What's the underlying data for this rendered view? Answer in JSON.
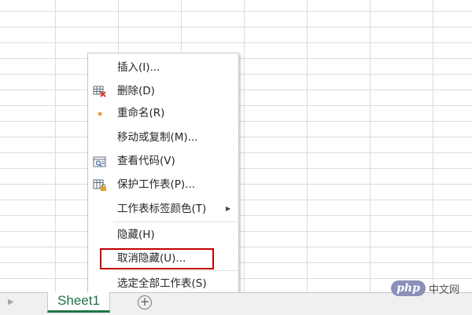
{
  "sheet_tabs": {
    "active_tab": "Sheet1",
    "add_symbol": "+",
    "nav_arrow": "▶"
  },
  "context_menu": {
    "items": [
      {
        "label": "插入(I)...",
        "icon": ""
      },
      {
        "label": "删除(D)",
        "icon": "delete-sheet-icon"
      },
      {
        "label": "重命名(R)",
        "icon": "dot-icon"
      },
      {
        "label": "移动或复制(M)...",
        "icon": ""
      },
      {
        "label": "查看代码(V)",
        "icon": "view-code-icon"
      },
      {
        "label": "保护工作表(P)...",
        "icon": "protect-sheet-icon"
      },
      {
        "label": "工作表标签颜色(T)",
        "icon": "",
        "submenu": true
      },
      {
        "label": "隐藏(H)",
        "icon": ""
      },
      {
        "label": "取消隐藏(U)...",
        "icon": "",
        "highlighted": true
      },
      {
        "label": "选定全部工作表(S)",
        "icon": ""
      }
    ],
    "submenu_arrow": "▶"
  },
  "colors": {
    "accent_green": "#217346",
    "highlight_red": "#c00000",
    "delete_red": "#e03c31",
    "dot_orange": "#e8a33c"
  },
  "watermark": {
    "badge": "php",
    "text": "中文网"
  }
}
